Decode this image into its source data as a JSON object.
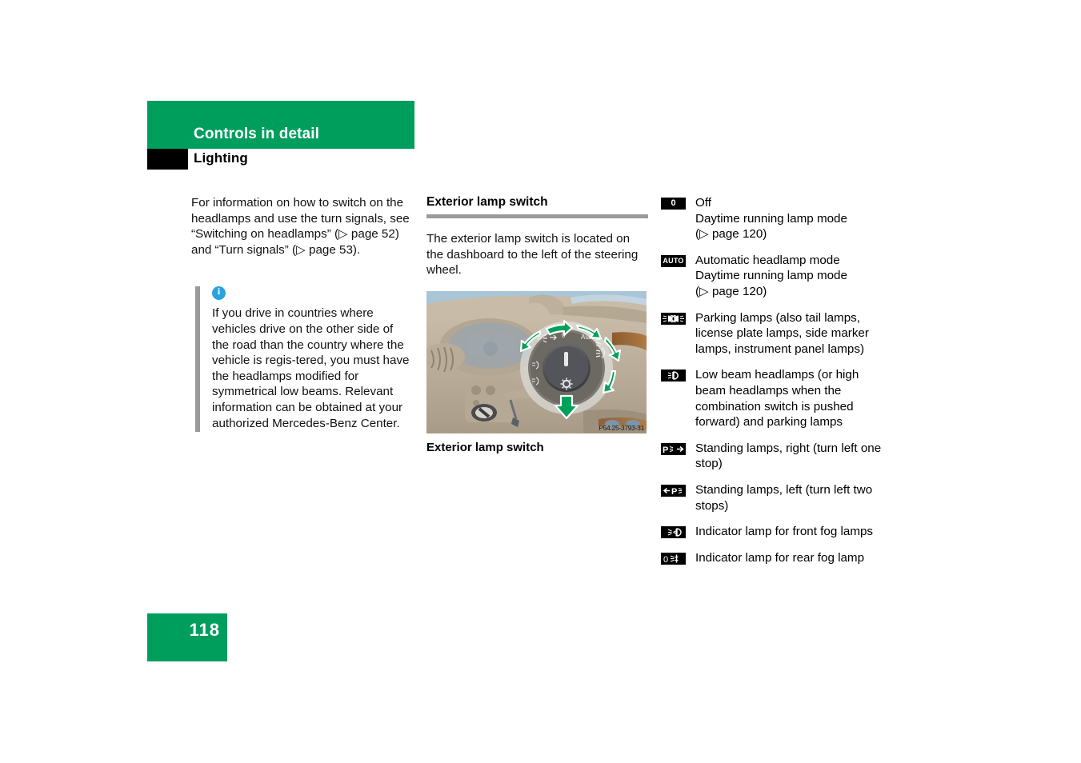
{
  "header": {
    "title": "Controls in detail",
    "subtitle": "Lighting"
  },
  "colors": {
    "brand_green": "#009E5C",
    "info_blue": "#29A3DF",
    "rule_gray": "#9a9a9a",
    "badge_black": "#000000"
  },
  "left_column": {
    "intro_paragraph": "For information on how to switch on the headlamps and use the turn signals, see “Switching on headlamps” (▷ page 52) and “Turn signals” (▷ page 53).",
    "info_box": {
      "icon": "info-circle-icon",
      "text": "If you drive in countries where vehicles drive on the other side of the road than the country where the vehicle is regis-tered, you must have the headlamps modified for symmetrical low beams. Relevant information can be obtained at your authorized Mercedes-Benz Center."
    }
  },
  "middle_column": {
    "heading": "Exterior lamp switch",
    "paragraph": "The exterior lamp switch is located on the dashboard to the left of the steering wheel.",
    "figure": {
      "alt": "Dashboard with rotary exterior lamp switch and green rotation arrows",
      "image_id": "P54.25-3793-31",
      "caption": "Exterior lamp switch",
      "dial_labels": [
        "P",
        "0",
        "Auto"
      ]
    }
  },
  "right_column": {
    "legend": [
      {
        "icon": "lamp-off-badge-icon",
        "glyph": "0",
        "glyph_type": "text",
        "lines": [
          "Off",
          "Daytime running lamp mode",
          "(▷ page 120)"
        ]
      },
      {
        "icon": "auto-headlamp-badge-icon",
        "glyph": "AUTO",
        "glyph_type": "text",
        "lines": [
          "Automatic headlamp mode",
          "Daytime running lamp mode",
          "(▷ page 120)"
        ]
      },
      {
        "icon": "parking-lamps-badge-icon",
        "glyph": "",
        "glyph_type": "svg-parking",
        "lines": [
          "Parking lamps (also tail lamps,",
          "license plate lamps, side marker",
          "lamps, instrument panel lamps)"
        ]
      },
      {
        "icon": "low-beam-headlamps-badge-icon",
        "glyph": "",
        "glyph_type": "svg-lowbeam",
        "lines": [
          "Low beam headlamps (or high",
          "beam headlamps when the",
          "combination switch is pushed",
          "forward) and parking lamps"
        ]
      },
      {
        "icon": "standing-lamps-right-badge-icon",
        "glyph": "",
        "glyph_type": "svg-standing-right",
        "lines": [
          "Standing lamps, right (turn left one",
          "stop)"
        ]
      },
      {
        "icon": "standing-lamps-left-badge-icon",
        "glyph": "",
        "glyph_type": "svg-standing-left",
        "lines": [
          "Standing lamps, left (turn left two",
          "stops)"
        ]
      },
      {
        "icon": "front-fog-lamp-badge-icon",
        "glyph": "",
        "glyph_type": "svg-frontfog",
        "lines": [
          "Indicator lamp for front fog lamps"
        ]
      },
      {
        "icon": "rear-fog-lamp-badge-icon",
        "glyph": "",
        "glyph_type": "svg-rearfog",
        "lines": [
          "Indicator lamp for rear fog lamp"
        ]
      }
    ]
  },
  "footer": {
    "page_number": "118"
  }
}
